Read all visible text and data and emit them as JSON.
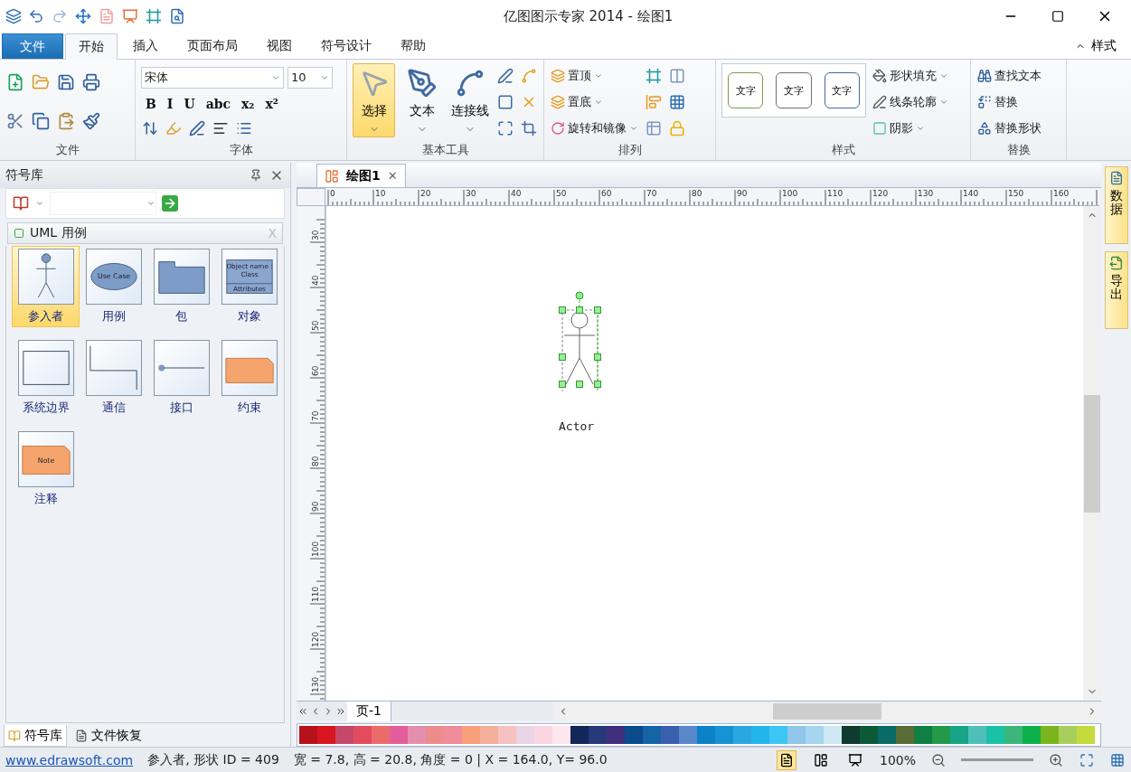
{
  "window": {
    "title": "亿图图示专家 2014 - 绘图1"
  },
  "ribbon_tabs": [
    {
      "label": "文件",
      "kind": "file",
      "selected": false
    },
    {
      "label": "开始",
      "kind": "tab",
      "selected": true
    },
    {
      "label": "插入",
      "kind": "tab",
      "selected": false
    },
    {
      "label": "页面布局",
      "kind": "tab",
      "selected": false
    },
    {
      "label": "视图",
      "kind": "tab",
      "selected": false
    },
    {
      "label": "符号设计",
      "kind": "tab",
      "selected": false
    },
    {
      "label": "帮助",
      "kind": "tab",
      "selected": false
    }
  ],
  "ribbon_style_menu": "样式",
  "groups": {
    "file": {
      "label": "文件"
    },
    "font": {
      "label": "字体",
      "font": "宋体",
      "size": "10",
      "format_buttons": [
        "B",
        "I",
        "U",
        "abc",
        "x₂",
        "x²"
      ]
    },
    "tools": {
      "label": "基本工具",
      "buttons": [
        {
          "label": "选择",
          "selected": true
        },
        {
          "label": "文本",
          "selected": false
        },
        {
          "label": "连接线",
          "selected": false
        }
      ]
    },
    "arrange": {
      "label": "排列",
      "items": [
        "置顶",
        "置底",
        "旋转和镜像"
      ]
    },
    "styles": {
      "label": "样式",
      "swatches": [
        {
          "label": "文字",
          "color": "#7a9a4a"
        },
        {
          "label": "文字",
          "color": "#707070"
        },
        {
          "label": "文字",
          "color": "#3f6aa0"
        }
      ],
      "commands": [
        "形状填充",
        "线条轮廓",
        "阴影"
      ]
    },
    "replace": {
      "label": "替换",
      "items": [
        "查找文本",
        "替换",
        "替换形状"
      ]
    }
  },
  "library": {
    "title": "符号库",
    "category": "UML 用例",
    "category_close": "X",
    "shapes": [
      {
        "label": "参入者",
        "kind": "actor",
        "selected": true
      },
      {
        "label": "用例",
        "kind": "usecase",
        "selected": false,
        "thumb_text": [
          "Use Case"
        ]
      },
      {
        "label": "包",
        "kind": "package",
        "selected": false
      },
      {
        "label": "对象",
        "kind": "object",
        "selected": false,
        "thumb_text": [
          "Object name :",
          "Class",
          "Attributes"
        ]
      },
      {
        "label": "系统边界",
        "kind": "boundary",
        "selected": false
      },
      {
        "label": "通信",
        "kind": "communication",
        "selected": false
      },
      {
        "label": "接口",
        "kind": "interface",
        "selected": false
      },
      {
        "label": "约束",
        "kind": "constraint",
        "selected": false
      },
      {
        "label": "注释",
        "kind": "note",
        "selected": false,
        "thumb_text": [
          "Note"
        ]
      }
    ],
    "bottom_tabs": [
      {
        "label": "符号库",
        "selected": true
      },
      {
        "label": "文件恢复",
        "selected": false
      }
    ]
  },
  "document_tab": {
    "label": "绘图1",
    "close": "✕"
  },
  "ruler": {
    "horizontal": [
      "0",
      "10",
      "20",
      "30",
      "40",
      "50",
      "60",
      "70",
      "80",
      "90",
      "100",
      "110",
      "120",
      "130",
      "140",
      "150",
      "160"
    ],
    "vertical": [
      "30",
      "40",
      "50",
      "60",
      "70",
      "80",
      "90",
      "100",
      "110",
      "120",
      "130"
    ]
  },
  "canvas": {
    "shape_label": "Actor"
  },
  "side_tabs": [
    "数据",
    "导出"
  ],
  "page_tab": "页-1",
  "palette": [
    {
      "color": "#b5121b"
    },
    {
      "color": "#d7161f"
    },
    {
      "color": "#c6476b"
    },
    {
      "color": "#e34c5f"
    },
    {
      "color": "#eb6b6b"
    },
    {
      "color": "#e25d9a"
    },
    {
      "color": "#e58fb0"
    },
    {
      "color": "#ec8c8c"
    },
    {
      "color": "#ef8d9b"
    },
    {
      "color": "#f7a07b"
    },
    {
      "color": "#f4b09c"
    },
    {
      "color": "#f6c2c1"
    },
    {
      "color": "#ead5e6"
    },
    {
      "color": "#fbd5e2"
    },
    {
      "color": "#fde6ee"
    },
    {
      "color": "#13265a"
    },
    {
      "color": "#28397a"
    },
    {
      "color": "#3f2f7d"
    },
    {
      "color": "#0a4b8c"
    },
    {
      "color": "#1565a6"
    },
    {
      "color": "#3a5fad"
    },
    {
      "color": "#5a87c9"
    },
    {
      "color": "#0b82c8"
    },
    {
      "color": "#1693d4"
    },
    {
      "color": "#2aa7df"
    },
    {
      "color": "#22b5ec"
    },
    {
      "color": "#3cc6f3"
    },
    {
      "color": "#8fc6ea"
    },
    {
      "color": "#a6d6ef"
    },
    {
      "color": "#cfe8f3"
    },
    {
      "color": "#0e3b2f"
    },
    {
      "color": "#0b5937"
    },
    {
      "color": "#0a6a66"
    },
    {
      "color": "#5a6b35"
    },
    {
      "color": "#0f7f42"
    },
    {
      "color": "#239a48"
    },
    {
      "color": "#17a489"
    },
    {
      "color": "#4fbfb9"
    },
    {
      "color": "#19c2a7"
    },
    {
      "color": "#3db679"
    },
    {
      "color": "#0db14b"
    },
    {
      "color": "#7ab51d"
    },
    {
      "color": "#a8cf5e"
    },
    {
      "color": "#c5da3c"
    }
  ],
  "status_bar": {
    "link": "www.edrawsoft.com",
    "shape_info": "参入者, 形状 ID = 409",
    "geometry": "宽 = 7.8, 高 = 20.8, 角度 = 0 | X = 164.0, Y= 96.0",
    "zoom": "100%"
  }
}
